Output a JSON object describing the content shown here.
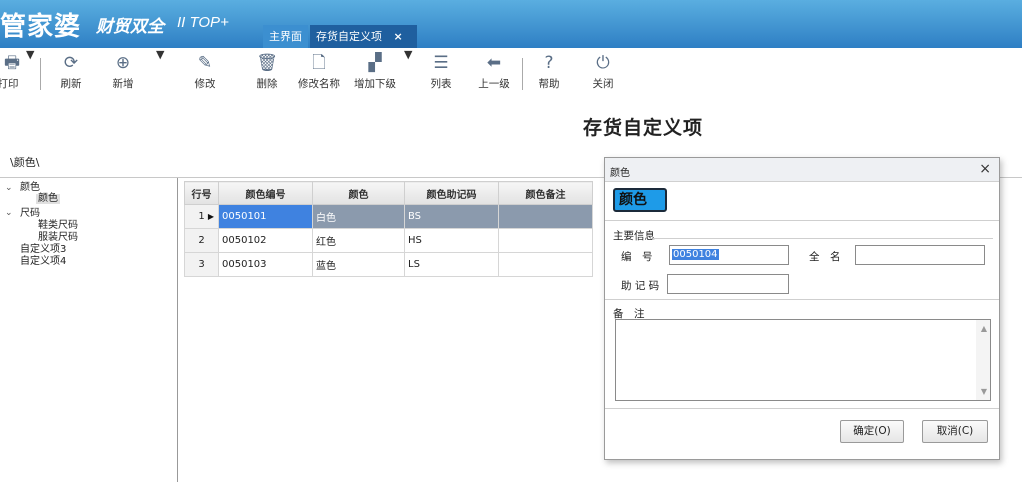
{
  "app": {
    "brand": "管家婆",
    "brand_sub": "财贸双全",
    "brand_version": "II TOP+",
    "tabs": [
      {
        "label": "主界面"
      },
      {
        "label": "存货自定义项",
        "close": "×"
      }
    ]
  },
  "toolbar": {
    "print": "打印",
    "refresh": "刷新",
    "add": "新增",
    "edit": "修改",
    "delete": "删除",
    "rename": "修改名称",
    "add_child": "增加下级",
    "list": "列表",
    "up": "上一级",
    "help": "帮助",
    "close": "关闭"
  },
  "page": {
    "title": "存货自定义项",
    "breadcrumb": "\\颜色\\"
  },
  "tree": [
    {
      "label": "颜色",
      "expanded": true
    },
    {
      "label": "颜色",
      "selected": true
    },
    {
      "label": "尺码",
      "expanded": true
    },
    {
      "label": "鞋类尺码"
    },
    {
      "label": "服装尺码"
    },
    {
      "label": "自定义项3"
    },
    {
      "label": "自定义项4"
    }
  ],
  "grid": {
    "headers": [
      "行号",
      "颜色编号",
      "颜色",
      "颜色助记码",
      "颜色备注"
    ],
    "rows": [
      {
        "no": "1",
        "code": "0050101",
        "name": "白色",
        "mnemonic": "BS",
        "remark": ""
      },
      {
        "no": "2",
        "code": "0050102",
        "name": "红色",
        "mnemonic": "HS",
        "remark": ""
      },
      {
        "no": "3",
        "code": "0050103",
        "name": "蓝色",
        "mnemonic": "LS",
        "remark": ""
      }
    ]
  },
  "dialog": {
    "title": "颜色",
    "close": "×",
    "badge": "颜色",
    "section_main": "主要信息",
    "code_label": "编　号",
    "code_value": "0050104",
    "fullname_label": "全　名",
    "fullname_value": "",
    "mnemonic_label": "助 记 码",
    "mnemonic_value": "",
    "notes_label": "备　注",
    "ok": "确定(O)",
    "cancel": "取消(C)"
  },
  "colors": {
    "titlebar": "#2e7fc4",
    "badge": "#1e9be8",
    "selection": "#3f82e0"
  }
}
